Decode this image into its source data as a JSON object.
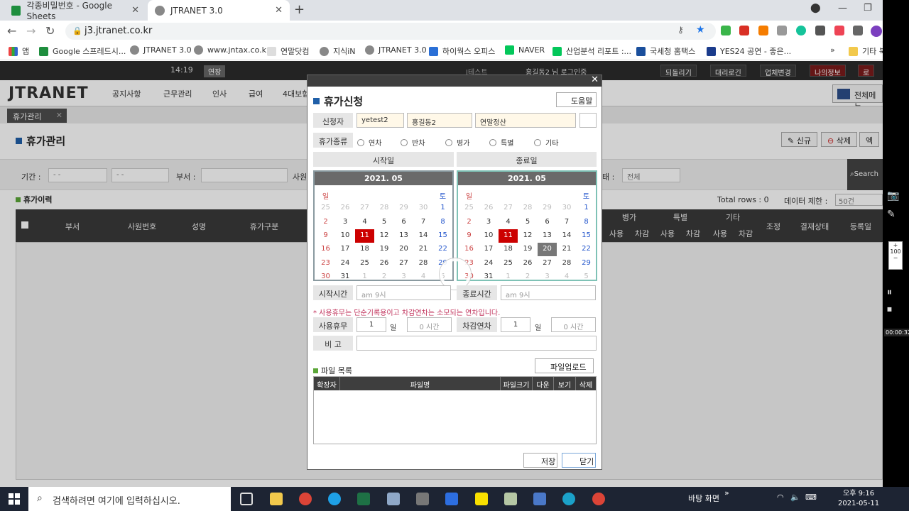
{
  "browser": {
    "tabs": [
      {
        "title": "각종비밀번호 - Google Sheets",
        "active": false
      },
      {
        "title": "JTRANET 3.0",
        "active": true
      }
    ],
    "url": "j3.jtranet.co.kr",
    "bookmarks": [
      "앱",
      "Google 스프레드시...",
      "JTRANET 3.0",
      "www.jntax.co.kr",
      "연말닷컴",
      "지식iN",
      "JTRANET 3.0",
      "하이웍스 오피스",
      "NAVER",
      "산업분석 리포트 :...",
      "국세청 홈택스",
      "YES24 공연 - 좋은...",
      "기타 북"
    ]
  },
  "site": {
    "clock": "14:19",
    "extend_label": "연장",
    "test_label": "J테스트",
    "login_user": "홍길동2 님 로그인중",
    "top_buttons": [
      "되돌리기",
      "대리로긴",
      "업체변경",
      "나의정보",
      "로"
    ],
    "logo": "JTRANET",
    "menu": [
      "공지사항",
      "근무관리",
      "인사",
      "급여",
      "4대보험"
    ],
    "all_menu": "전체메뉴",
    "page_tab": "휴가관리",
    "page_title": "휴가관리",
    "actions": [
      "신규",
      "삭제",
      "엑"
    ],
    "filters": {
      "period_label": "기간 :",
      "date_from": "- -",
      "date_to": "- -",
      "dept_label": "부서 :",
      "emp_label": "사원",
      "status_label": "태 :",
      "status_value": "전체",
      "search_label": "Search"
    },
    "list_title": "휴가이력",
    "total_rows": "Total rows : 0",
    "data_limit_label": "데이터 제한 :",
    "data_limit_value": "50건",
    "grid_columns": [
      "부서",
      "사원번호",
      "성명",
      "휴가구분"
    ],
    "grid_right_groups": [
      "병가",
      "특별",
      "기타"
    ],
    "grid_right_sub": [
      "사용",
      "차감",
      "사용",
      "차감",
      "사용",
      "차감"
    ],
    "grid_right_cols": [
      "조정",
      "결재상태",
      "등록일"
    ]
  },
  "modal": {
    "title": "휴가신청",
    "help_label": "도움말",
    "applicant_label": "신청자",
    "applicant_id": "yetest2",
    "applicant_name": "홍길동2",
    "applicant_dept": "연말정산",
    "type_label": "휴가종류",
    "types": [
      "연차",
      "반차",
      "병가",
      "특별",
      "기타"
    ],
    "start_label": "시작일",
    "end_label": "종료일",
    "calendar_month": "2021. 05",
    "weekday_sun": "일",
    "weekday_sat": "토",
    "calendar_weeks": [
      [
        25,
        26,
        27,
        28,
        29,
        30,
        1
      ],
      [
        2,
        3,
        4,
        5,
        6,
        7,
        8
      ],
      [
        9,
        10,
        11,
        12,
        13,
        14,
        15
      ],
      [
        16,
        17,
        18,
        19,
        20,
        21,
        22
      ],
      [
        23,
        24,
        25,
        26,
        27,
        28,
        29
      ],
      [
        30,
        31,
        1,
        2,
        3,
        4,
        5
      ]
    ],
    "today": 11,
    "hover_day_end": 20,
    "start_time_label": "시작시간",
    "start_time": "am 9시",
    "end_time_label": "종료시간",
    "end_time": "am 9시",
    "note": "* 사용휴무는 단순기록용이고 차감연차는 소모되는 연차입니다.",
    "use_label": "사용휴무",
    "use_days": "1",
    "day_unit": "일",
    "use_hours": "0 시간",
    "deduct_label": "차감연차",
    "deduct_days": "1",
    "deduct_hours": "0 시간",
    "remark_label": "비 고",
    "file_list_title": "파일 목록",
    "upload_label": "파일업로드",
    "file_columns": [
      "확장자",
      "파일명",
      "파일크기",
      "다운",
      "보기",
      "삭제"
    ],
    "save_label": "저장",
    "close_label": "닫기"
  },
  "recorder": {
    "zoom": "100",
    "time": "00:00:32"
  },
  "taskbar": {
    "search_placeholder": "검색하려면 여기에 입력하십시오.",
    "desktop_label": "바탕 화면",
    "time": "오후 9:16",
    "date": "2021-05-11"
  }
}
